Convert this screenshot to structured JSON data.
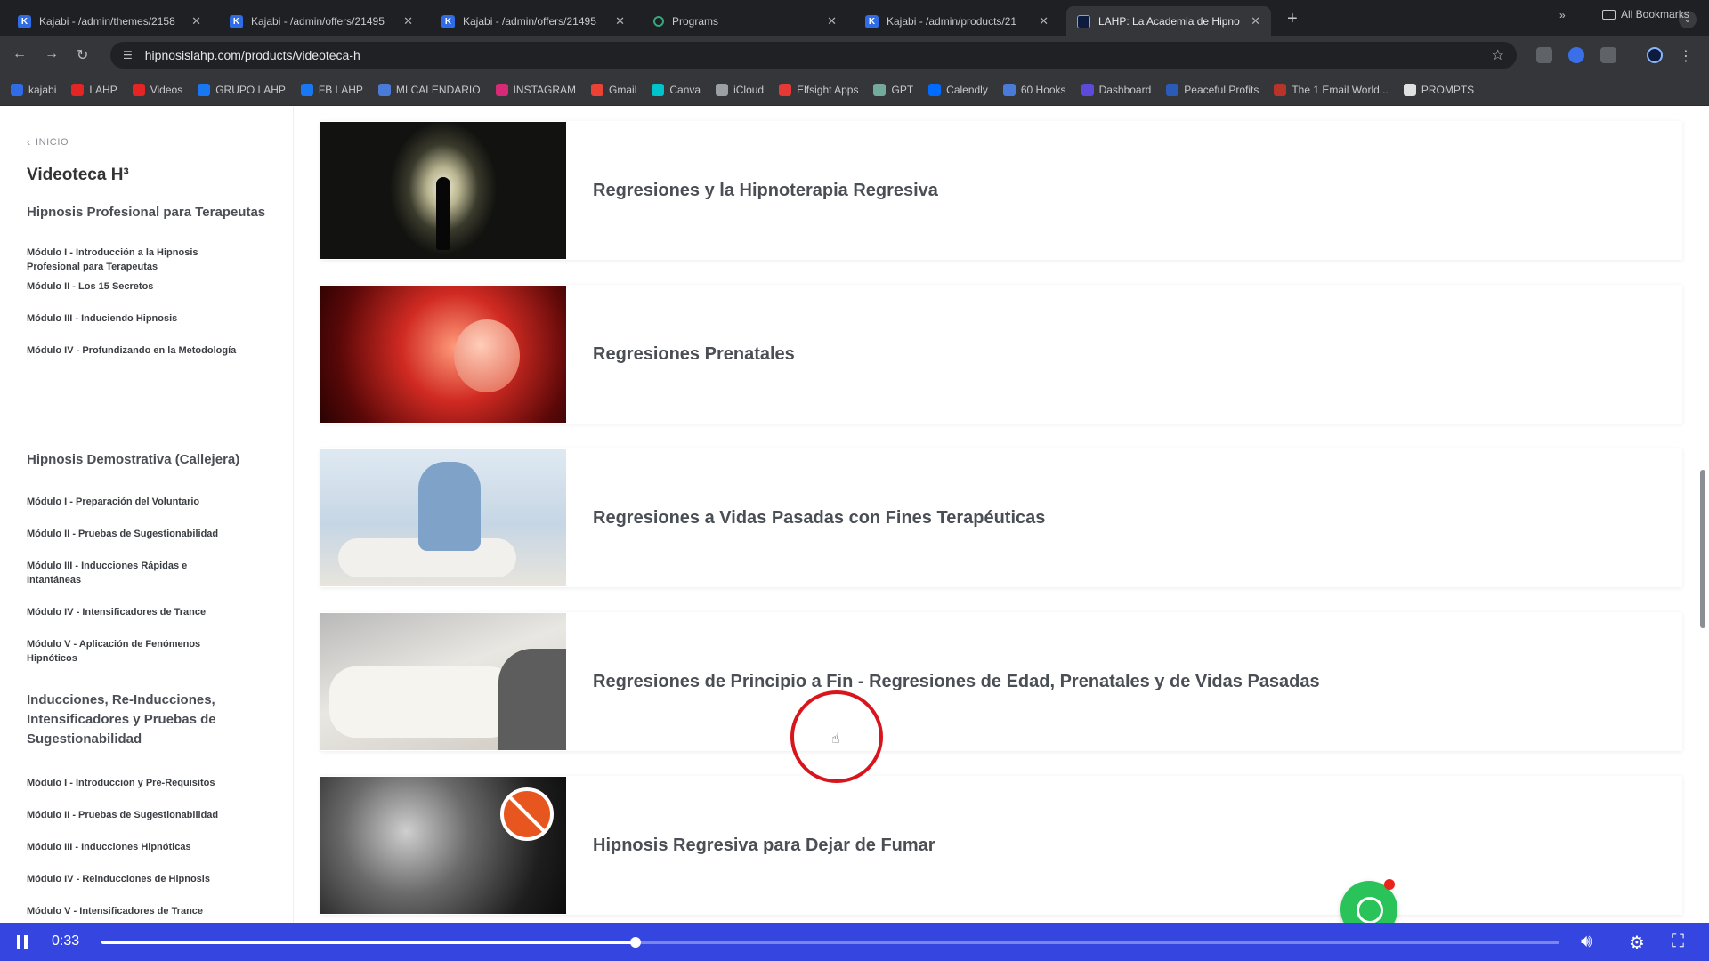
{
  "browser": {
    "tabs": [
      {
        "label": "Kajabi - /admin/themes/2158",
        "favicon": "K",
        "active": false
      },
      {
        "label": "Kajabi - /admin/offers/21495",
        "favicon": "K",
        "active": false
      },
      {
        "label": "Kajabi - /admin/offers/21495",
        "favicon": "K",
        "active": false
      },
      {
        "label": "Programs",
        "favicon": "",
        "active": false
      },
      {
        "label": "Kajabi - /admin/products/21",
        "favicon": "K",
        "active": false
      },
      {
        "label": "LAHP: La Academia de Hipno",
        "favicon": "",
        "active": true
      }
    ],
    "new_tab": "+",
    "url": "hipnosislahp.com/products/videoteca-h",
    "bookmarks": [
      {
        "label": "kajabi",
        "color": "#2f6ce5"
      },
      {
        "label": "LAHP",
        "color": "#e52424"
      },
      {
        "label": "Videos",
        "color": "#e52424"
      },
      {
        "label": "GRUPO LAHP",
        "color": "#1877f2"
      },
      {
        "label": "FB LAHP",
        "color": "#1877f2"
      },
      {
        "label": "MI CALENDARIO",
        "color": "#4a7bd8"
      },
      {
        "label": "INSTAGRAM",
        "color": "#d62976"
      },
      {
        "label": "Gmail",
        "color": "#ea4335"
      },
      {
        "label": "Canva",
        "color": "#00c4cc"
      },
      {
        "label": "iCloud",
        "color": "#9aa0a6"
      },
      {
        "label": "Elfsight Apps",
        "color": "#e53935"
      },
      {
        "label": "GPT",
        "color": "#74aa9c"
      },
      {
        "label": "Calendly",
        "color": "#006bff"
      },
      {
        "label": "60 Hooks",
        "color": "#4a7bd8"
      },
      {
        "label": "Dashboard",
        "color": "#5b4bd8"
      },
      {
        "label": "Peaceful Profits",
        "color": "#2a5bb8"
      },
      {
        "label": "The 1 Email World...",
        "color": "#b8332a"
      },
      {
        "label": "PROMPTS",
        "color": "#e0e0e0"
      }
    ],
    "bookmarks_more": "»",
    "all_bookmarks": "All Bookmarks"
  },
  "sidebar": {
    "back_label": "INICIO",
    "product_title": "Videoteca H³",
    "sections": [
      {
        "title": "Hipnosis Profesional para Terapeutas",
        "lessons": [
          "Módulo I - Introducción a la Hipnosis Profesional para Terapeutas",
          "Módulo II - Los 15 Secretos",
          "Módulo III - Induciendo Hipnosis",
          "Módulo IV - Profundizando en la Metodología"
        ]
      },
      {
        "title": "Hipnosis Demostrativa (Callejera)",
        "lessons": [
          "Módulo I - Preparación del Voluntario",
          "Módulo II - Pruebas de Sugestionabilidad",
          "Módulo III - Inducciones Rápidas e Intantáneas",
          "Módulo IV - Intensificadores de Trance",
          "Módulo V - Aplicación de Fenómenos Hipnóticos"
        ]
      },
      {
        "title": "Inducciones, Re-Inducciones, Intensificadores y Pruebas de Sugestionabilidad",
        "lessons": [
          "Módulo I - Introducción y Pre-Requisitos",
          "Módulo II - Pruebas de Sugestionabilidad",
          "Módulo III - Inducciones Hipnóticas",
          "Módulo IV - Reinducciones de Hipnosis",
          "Módulo V - Intensificadores de Trance"
        ]
      }
    ]
  },
  "main": {
    "cards": [
      {
        "title": "Regresiones y la Hipnoterapia Regresiva"
      },
      {
        "title": "Regresiones Prenatales"
      },
      {
        "title": "Regresiones a Vidas Pasadas con Fines Terapéuticas"
      },
      {
        "title": "Regresiones de Principio a Fin - Regresiones de Edad, Prenatales y de Vidas Pasadas"
      },
      {
        "title": "Hipnosis Regresiva para Dejar de Fumar"
      }
    ]
  },
  "player": {
    "current_time": "0:33",
    "progress": 0.366
  },
  "colors": {
    "player_bar": "#3546e0",
    "cursor_ring": "#d8151c",
    "whatsapp": "#29c35a"
  }
}
